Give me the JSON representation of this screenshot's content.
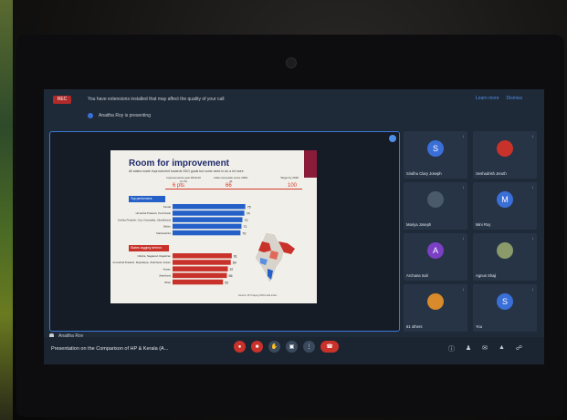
{
  "warning": {
    "rec_label": "REC",
    "text": "You have extensions installed that may affect the quality of your call",
    "actions": [
      "Learn more",
      "Dismiss"
    ]
  },
  "presenting": {
    "text": "Anaitha Roy is presenting"
  },
  "slide": {
    "title": "Room for improvement",
    "subtitle": "All states made improvement towards SDG goals but some need to do a lot more",
    "legend": [
      {
        "label": "Improvements year 2019-20 (in %)",
        "value": "6 pts"
      },
      {
        "label": "India composite score 2020-21",
        "value": "66"
      },
      {
        "label": "Target by 2030",
        "value": "100"
      }
    ],
    "top_section": "Top performers",
    "lagging_section": "States lagging behind",
    "source": "Source: NITI Aayog SDG India Index",
    "accent_color": "#2460c8",
    "lagging_color": "#c8322a"
  },
  "chart_data": {
    "type": "bar",
    "title": "Room for improvement",
    "series": [
      {
        "name": "Top performers",
        "categories": [
          "Kerala",
          "Himachal Pradesh, Tamil Nadu",
          "Andhra Pradesh, Goa, Karnataka, Uttarakhand",
          "Sikkim",
          "Maharashtra"
        ],
        "values": [
          75,
          74,
          72,
          71,
          70
        ]
      },
      {
        "name": "States lagging behind",
        "categories": [
          "Odisha, Nagaland, Rajasthan",
          "Arunachal Pradesh, Meghalaya, Jharkhand, Assam",
          "Assam",
          "Jharkhand",
          "Bihar"
        ],
        "values": [
          61,
          60,
          57,
          56,
          52
        ]
      }
    ],
    "xlim": [
      0,
      100
    ]
  },
  "stage": {
    "presenter_name": "Anaitha Roy"
  },
  "participants": [
    {
      "initial": "S",
      "name": "Sindhu Clary Joseph",
      "color": "#3a6fd8",
      "photo": false
    },
    {
      "initial": "",
      "name": "Seshadrish Jeruth",
      "color": "#c8322a",
      "photo": true
    },
    {
      "initial": "",
      "name": "Mariya Joseph",
      "color": "#4a5a6a",
      "photo": true
    },
    {
      "initial": "M",
      "name": "Mini Roy",
      "color": "#3a6fd8",
      "photo": false
    },
    {
      "initial": "A",
      "name": "Archana Sali",
      "color": "#7b3fc4",
      "photo": false
    },
    {
      "initial": "",
      "name": "Agnus Shaji",
      "color": "#8a9a6a",
      "photo": true
    },
    {
      "initial": "",
      "name": "61 others",
      "color": "#d98a2a",
      "photo": false
    },
    {
      "initial": "S",
      "name": "You",
      "color": "#3a6fd8",
      "photo": false
    }
  ],
  "toolbar": {
    "meeting_title": "Presentation on the Comparison of HP & Kerala (A...",
    "controls": [
      "mic-off",
      "camera-off",
      "raise-hand",
      "present",
      "more"
    ],
    "end_call": "end-call"
  }
}
